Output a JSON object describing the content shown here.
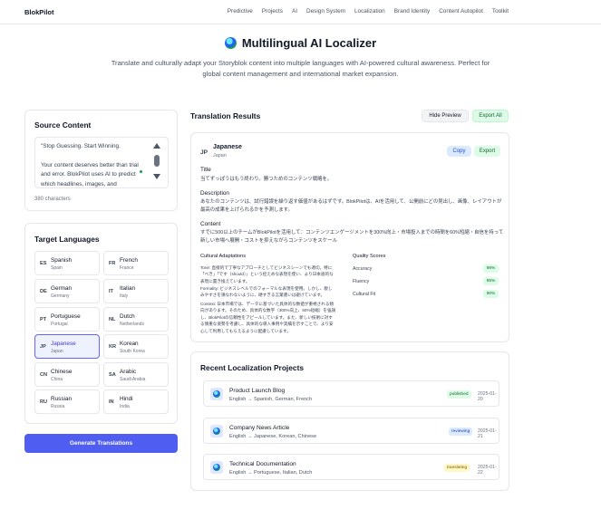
{
  "nav": {
    "brand": "BlokPilot",
    "links": [
      "Predictive",
      "Projects",
      "AI",
      "Design System",
      "Localization",
      "Brand Identity",
      "Content Autopilot",
      "Toolkit"
    ]
  },
  "hero": {
    "title": "Multilingual AI Localizer",
    "description": "Translate and culturally adapt your Storyblok content into multiple languages with AI-powered cultural awareness. Perfect for global content management and international market expansion."
  },
  "source": {
    "title": "Source Content",
    "text": "\"Stop Guessing. Start Winning.\n\nYour content deserves better than trial and error. BlokPilot uses AI to predict which headlines, images, and",
    "char_count": "380 characters"
  },
  "target": {
    "title": "Target Languages",
    "languages": [
      {
        "code": "ES",
        "name": "Spanish",
        "native": "Spain"
      },
      {
        "code": "FR",
        "name": "French",
        "native": "France"
      },
      {
        "code": "DE",
        "name": "German",
        "native": "Germany"
      },
      {
        "code": "IT",
        "name": "Italian",
        "native": "Italy"
      },
      {
        "code": "PT",
        "name": "Portuguese",
        "native": "Portugal"
      },
      {
        "code": "NL",
        "name": "Dutch",
        "native": "Netherlands"
      },
      {
        "code": "JP",
        "name": "Japanese",
        "native": "Japan"
      },
      {
        "code": "KR",
        "name": "Korean",
        "native": "South Korea"
      },
      {
        "code": "CN",
        "name": "Chinese",
        "native": "China"
      },
      {
        "code": "SA",
        "name": "Arabic",
        "native": "Saudi Arabia"
      },
      {
        "code": "RU",
        "name": "Russian",
        "native": "Russia"
      },
      {
        "code": "IN",
        "name": "Hindi",
        "native": "India"
      }
    ],
    "generate_label": "Generate Translations"
  },
  "results": {
    "title": "Translation Results",
    "hide_label": "Hide Preview",
    "export_all_label": "Export All",
    "card": {
      "code": "JP",
      "name": "Japanese",
      "native": "Japan",
      "copy_label": "Copy",
      "export_label": "Export",
      "title_label": "Title",
      "title_text": "当てずっぽうはもう終わり。勝つためのコンテンツ戦略を。",
      "description_label": "Description",
      "description_text": "あなたのコンテンツは、試行錯誤を繰り返す価値があるはずです。BlokPilotは、AIを活用して、公開前にどの見出し、画像、レイアウトが最高の成果を上げられるかを予測します。",
      "content_label": "Content",
      "content_text": "すでに500以上のチームがBlokPilotを活用して：コンテンツエンゲージメントを300%向上・市場投入までの時間を60%短縮・自信を持って新しい市場へ展開・コストを抑えながらコンテンツをスケール",
      "adaptations_label": "Cultural Adaptations",
      "adaptations": [
        "Tone: 直接的で丁寧なアプローチとしてビジネスシーンでも適切。特に「べき」「です（should）」という控えめな表現を使い、より日本語的な表現に置き換えています。",
        "Formality: ビジネスレベルでのフォーマルな表現を使用。しかし、親しみやすさを損なわないように、硬すぎる言葉遣いは避けています。",
        "Context: 日本市場では、データに基づいた具体的な数値が重視される傾向があります。そのため、具体的な数字（300%向上、60%短縮）を強調し、BlokPilotの信頼性をアピールしています。また、新しい技術に対する慎重な姿勢を考慮し、具体的な導入事例や実績を示すことで、より安心して利用してもらえるように配慮しています。"
      ],
      "quality_label": "Quality Scores",
      "quality": [
        {
          "label": "Accuracy",
          "value": "98%"
        },
        {
          "label": "Fluency",
          "value": "95%"
        },
        {
          "label": "Cultural Fit",
          "value": "90%"
        }
      ]
    }
  },
  "recent": {
    "title": "Recent Localization Projects",
    "projects": [
      {
        "title": "Product Launch Blog",
        "langs": "English → Spanish, German, French",
        "status": "published",
        "date": "2025-01-20"
      },
      {
        "title": "Company News Article",
        "langs": "English → Japanese, Korean, Chinese",
        "status": "reviewing",
        "date": "2025-01-21"
      },
      {
        "title": "Technical Documentation",
        "langs": "English → Portuguese, Italian, Dutch",
        "status": "translating",
        "date": "2025-01-22"
      }
    ]
  }
}
